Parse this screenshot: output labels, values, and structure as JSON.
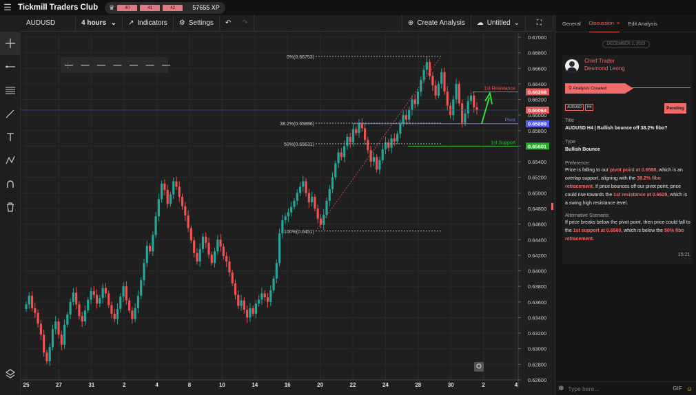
{
  "app": {
    "title": "Tickmill Traders Club",
    "xp_pills": [
      "40",
      "41",
      "42"
    ],
    "xp": "57655 XP"
  },
  "chartbar": {
    "symbol": "AUDUSD",
    "timeframe": "4 hours",
    "indicators": "Indicators",
    "settings": "Settings",
    "create": "Create Analysis",
    "untitled": "Untitled"
  },
  "panel": {
    "tabs": [
      "General",
      "Discussion",
      "Edit Analysis"
    ],
    "date": "DECEMBER 1, 2023",
    "author_role": "Chief Trader",
    "author_name": "Desmond Leong",
    "event": "Analysis Created",
    "tags": [
      "AUDUSD",
      "H4"
    ],
    "status": "Pending",
    "title_label": "Title",
    "title": "AUDUSD H4 | Bullish bounce off 38.2% fibo?",
    "type_label": "Type",
    "type": "Bullish Bounce",
    "pref_label": "Preference:",
    "pref_parts": [
      [
        "Price is falling to our ",
        false
      ],
      [
        "pivot point at 0.6588",
        true
      ],
      [
        ", which is an overlap support, aligning with the ",
        false
      ],
      [
        "38.2% fibo retracement",
        true
      ],
      [
        ". If price bounces off our pivot point, price could rise towards the ",
        false
      ],
      [
        "1st resistance at 0.6629",
        true
      ],
      [
        ", which is a swing high resistance level.",
        false
      ]
    ],
    "alt_label": "Alternative Scenario:",
    "alt_parts": [
      [
        "If price breaks below the pivot point, then price could fall to the ",
        false
      ],
      [
        "1st support at 0.6560",
        true
      ],
      [
        ", which is below the ",
        false
      ],
      [
        "50% fibo retracement.",
        true
      ]
    ],
    "time": "15:21",
    "placeholder": "Type here...",
    "gif": "GIF"
  },
  "chart_data": {
    "type": "candlestick",
    "symbol": "AUDUSD",
    "timeframe": "H4",
    "y_ticks": [
      "0.67000",
      "0.66800",
      "0.66600",
      "0.66400",
      "0.66200",
      "0.66000",
      "0.65800",
      "0.65600",
      "0.65400",
      "0.65200",
      "0.65000",
      "0.64800",
      "0.64600",
      "0.64400",
      "0.64200",
      "0.64000",
      "0.63800",
      "0.63600",
      "0.63400",
      "0.63200",
      "0.63000",
      "0.62800",
      "0.62600"
    ],
    "ylim": [
      0.626,
      0.67
    ],
    "x_ticks": [
      "25",
      "27",
      "31",
      "2",
      "4",
      "8",
      "10",
      "14",
      "16",
      "20",
      "22",
      "24",
      "28",
      "30",
      "2",
      "4"
    ],
    "fib_levels": [
      {
        "label": "0%(0.66753)",
        "value": 0.66753
      },
      {
        "label": "38.2%(0.65896)",
        "value": 0.65896
      },
      {
        "label": "50%(0.65631)",
        "value": 0.65631
      },
      {
        "label": "100%(0.6451)",
        "value": 0.6451
      }
    ],
    "lines": [
      {
        "name": "1st Resistance",
        "value": 0.66298,
        "color": "#f05454"
      },
      {
        "name": "Pivot",
        "value": 0.65889,
        "color": "#6f72ff"
      },
      {
        "name": "1st Support",
        "value": 0.65601,
        "color": "#33c233"
      }
    ],
    "price_tags": [
      {
        "label": "0.66298",
        "color": "#f05454"
      },
      {
        "label": "0.66064",
        "color": "#f05454"
      },
      {
        "label": "0.65889",
        "color": "#5559ff"
      },
      {
        "label": "0.65601",
        "color": "#2aa82a"
      }
    ],
    "closes": [
      0.6357,
      0.6368,
      0.6352,
      0.6346,
      0.6332,
      0.6318,
      0.6295,
      0.6284,
      0.6302,
      0.6325,
      0.6335,
      0.6318,
      0.6305,
      0.6331,
      0.6344,
      0.636,
      0.6372,
      0.6357,
      0.6342,
      0.6335,
      0.6349,
      0.6363,
      0.6374,
      0.6369,
      0.6358,
      0.6365,
      0.6378,
      0.6371,
      0.6356,
      0.6345,
      0.6338,
      0.6351,
      0.6367,
      0.638,
      0.6362,
      0.6349,
      0.6338,
      0.6352,
      0.6368,
      0.6388,
      0.641,
      0.6432,
      0.6425,
      0.6446,
      0.647,
      0.6492,
      0.6512,
      0.6504,
      0.6486,
      0.6498,
      0.6515,
      0.6508,
      0.6495,
      0.6483,
      0.6471,
      0.6455,
      0.6439,
      0.6423,
      0.6412,
      0.6428,
      0.6444,
      0.6436,
      0.6421,
      0.641,
      0.6425,
      0.644,
      0.6431,
      0.6419,
      0.6412,
      0.6398,
      0.6384,
      0.6369,
      0.6355,
      0.6362,
      0.635,
      0.634,
      0.6352,
      0.6345,
      0.6358,
      0.6363,
      0.6371,
      0.6366,
      0.636,
      0.6375,
      0.639,
      0.641,
      0.6448,
      0.6465,
      0.647,
      0.6475,
      0.6482,
      0.649,
      0.65,
      0.6508,
      0.6515,
      0.65,
      0.6488,
      0.6495,
      0.648,
      0.6467,
      0.6459,
      0.6472,
      0.649,
      0.6505,
      0.652,
      0.6538,
      0.6552,
      0.6546,
      0.656,
      0.6572,
      0.6565,
      0.6582,
      0.6577,
      0.659,
      0.6583,
      0.6568,
      0.6555,
      0.654,
      0.6546,
      0.653,
      0.6542,
      0.6556,
      0.6565,
      0.6558,
      0.657,
      0.6566,
      0.6576,
      0.6589,
      0.66,
      0.6594,
      0.6607,
      0.662,
      0.6614,
      0.663,
      0.6645,
      0.6658,
      0.6668,
      0.665,
      0.6638,
      0.6625,
      0.664,
      0.6655,
      0.663,
      0.6612,
      0.66,
      0.662,
      0.664,
      0.6615,
      0.659,
      0.6602,
      0.6618,
      0.6625,
      0.661,
      0.6606
    ]
  }
}
